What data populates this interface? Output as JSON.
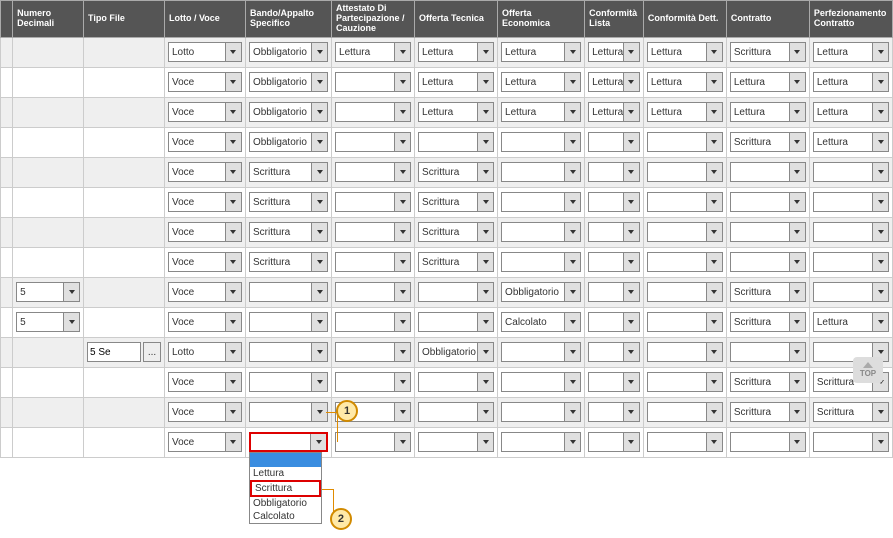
{
  "headers": [
    "Numero Decimali",
    "Tipo File",
    "Lotto / Voce",
    "Bando/Appalto Specifico",
    "Attestato Di Partecipazione / Cauzione",
    "Offerta Tecnica",
    "Offerta Economica",
    "Conformità Lista",
    "Conformità Dett.",
    "Contratto",
    "Perfezionamento Contratto"
  ],
  "rows": [
    {
      "bg": "even",
      "cells": {
        "c2": {
          "type": "sel",
          "val": "Lotto"
        },
        "c3": {
          "type": "sel",
          "val": "Obbligatorio"
        },
        "c4": {
          "type": "sel",
          "val": "Lettura"
        },
        "c5": {
          "type": "sel",
          "val": "Lettura"
        },
        "c6": {
          "type": "sel",
          "val": "Lettura"
        },
        "c7": {
          "type": "sel",
          "val": "Lettura"
        },
        "c8": {
          "type": "sel",
          "val": "Lettura"
        },
        "c9": {
          "type": "sel",
          "val": "Scrittura"
        },
        "c10": {
          "type": "sel",
          "val": "Lettura"
        }
      }
    },
    {
      "bg": "odd",
      "cells": {
        "c2": {
          "type": "sel",
          "val": "Voce"
        },
        "c3": {
          "type": "sel",
          "val": "Obbligatorio"
        },
        "c4": {
          "type": "sel",
          "val": ""
        },
        "c5": {
          "type": "sel",
          "val": "Lettura"
        },
        "c6": {
          "type": "sel",
          "val": "Lettura"
        },
        "c7": {
          "type": "sel",
          "val": "Lettura"
        },
        "c8": {
          "type": "sel",
          "val": "Lettura"
        },
        "c9": {
          "type": "sel",
          "val": "Lettura"
        },
        "c10": {
          "type": "sel",
          "val": "Lettura"
        }
      }
    },
    {
      "bg": "even",
      "cells": {
        "c2": {
          "type": "sel",
          "val": "Voce"
        },
        "c3": {
          "type": "sel",
          "val": "Obbligatorio"
        },
        "c4": {
          "type": "sel",
          "val": ""
        },
        "c5": {
          "type": "sel",
          "val": "Lettura"
        },
        "c6": {
          "type": "sel",
          "val": "Lettura"
        },
        "c7": {
          "type": "sel",
          "val": "Lettura"
        },
        "c8": {
          "type": "sel",
          "val": "Lettura"
        },
        "c9": {
          "type": "sel",
          "val": "Lettura"
        },
        "c10": {
          "type": "sel",
          "val": "Lettura"
        }
      }
    },
    {
      "bg": "odd",
      "cells": {
        "c2": {
          "type": "sel",
          "val": "Voce"
        },
        "c3": {
          "type": "sel",
          "val": "Obbligatorio"
        },
        "c4": {
          "type": "sel",
          "val": ""
        },
        "c5": {
          "type": "sel",
          "val": ""
        },
        "c6": {
          "type": "sel",
          "val": ""
        },
        "c7": {
          "type": "sel",
          "val": ""
        },
        "c8": {
          "type": "sel",
          "val": ""
        },
        "c9": {
          "type": "sel",
          "val": "Scrittura"
        },
        "c10": {
          "type": "sel",
          "val": "Lettura"
        }
      }
    },
    {
      "bg": "even",
      "cells": {
        "c2": {
          "type": "sel",
          "val": "Voce"
        },
        "c3": {
          "type": "sel",
          "val": "Scrittura"
        },
        "c4": {
          "type": "sel",
          "val": ""
        },
        "c5": {
          "type": "sel",
          "val": "Scrittura"
        },
        "c6": {
          "type": "sel",
          "val": ""
        },
        "c7": {
          "type": "sel",
          "val": ""
        },
        "c8": {
          "type": "sel",
          "val": ""
        },
        "c9": {
          "type": "sel",
          "val": ""
        },
        "c10": {
          "type": "sel",
          "val": ""
        }
      }
    },
    {
      "bg": "odd",
      "cells": {
        "c2": {
          "type": "sel",
          "val": "Voce"
        },
        "c3": {
          "type": "sel",
          "val": "Scrittura"
        },
        "c4": {
          "type": "sel",
          "val": ""
        },
        "c5": {
          "type": "sel",
          "val": "Scrittura"
        },
        "c6": {
          "type": "sel",
          "val": ""
        },
        "c7": {
          "type": "sel",
          "val": ""
        },
        "c8": {
          "type": "sel",
          "val": ""
        },
        "c9": {
          "type": "sel",
          "val": ""
        },
        "c10": {
          "type": "sel",
          "val": ""
        }
      }
    },
    {
      "bg": "even",
      "cells": {
        "c2": {
          "type": "sel",
          "val": "Voce"
        },
        "c3": {
          "type": "sel",
          "val": "Scrittura"
        },
        "c4": {
          "type": "sel",
          "val": ""
        },
        "c5": {
          "type": "sel",
          "val": "Scrittura"
        },
        "c6": {
          "type": "sel",
          "val": ""
        },
        "c7": {
          "type": "sel",
          "val": ""
        },
        "c8": {
          "type": "sel",
          "val": ""
        },
        "c9": {
          "type": "sel",
          "val": ""
        },
        "c10": {
          "type": "sel",
          "val": ""
        }
      }
    },
    {
      "bg": "odd",
      "cells": {
        "c2": {
          "type": "sel",
          "val": "Voce"
        },
        "c3": {
          "type": "sel",
          "val": "Scrittura"
        },
        "c4": {
          "type": "sel",
          "val": ""
        },
        "c5": {
          "type": "sel",
          "val": "Scrittura"
        },
        "c6": {
          "type": "sel",
          "val": ""
        },
        "c7": {
          "type": "sel",
          "val": ""
        },
        "c8": {
          "type": "sel",
          "val": ""
        },
        "c9": {
          "type": "sel",
          "val": ""
        },
        "c10": {
          "type": "sel",
          "val": ""
        }
      }
    },
    {
      "bg": "even",
      "cells": {
        "c0": {
          "type": "sel",
          "val": "5"
        },
        "c2": {
          "type": "sel",
          "val": "Voce"
        },
        "c3": {
          "type": "sel",
          "val": ""
        },
        "c4": {
          "type": "sel",
          "val": ""
        },
        "c5": {
          "type": "sel",
          "val": ""
        },
        "c6": {
          "type": "sel",
          "val": "Obbligatorio"
        },
        "c7": {
          "type": "sel",
          "val": ""
        },
        "c8": {
          "type": "sel",
          "val": ""
        },
        "c9": {
          "type": "sel",
          "val": "Scrittura"
        },
        "c10": {
          "type": "sel",
          "val": ""
        }
      }
    },
    {
      "bg": "odd",
      "cells": {
        "c0": {
          "type": "sel",
          "val": "5"
        },
        "c2": {
          "type": "sel",
          "val": "Voce"
        },
        "c3": {
          "type": "sel",
          "val": ""
        },
        "c4": {
          "type": "sel",
          "val": ""
        },
        "c5": {
          "type": "sel",
          "val": ""
        },
        "c6": {
          "type": "sel",
          "val": "Calcolato"
        },
        "c7": {
          "type": "sel",
          "val": ""
        },
        "c8": {
          "type": "sel",
          "val": ""
        },
        "c9": {
          "type": "sel",
          "val": "Scrittura"
        },
        "c10": {
          "type": "sel",
          "val": "Lettura"
        }
      }
    },
    {
      "bg": "even",
      "cells": {
        "c1": {
          "type": "tipo",
          "val": "5 Se"
        },
        "c2": {
          "type": "sel",
          "val": "Lotto"
        },
        "c3": {
          "type": "sel",
          "val": ""
        },
        "c4": {
          "type": "sel",
          "val": ""
        },
        "c5": {
          "type": "sel",
          "val": "Obbligatorio"
        },
        "c6": {
          "type": "sel",
          "val": ""
        },
        "c7": {
          "type": "sel",
          "val": ""
        },
        "c8": {
          "type": "sel",
          "val": ""
        },
        "c9": {
          "type": "sel",
          "val": ""
        },
        "c10": {
          "type": "sel",
          "val": ""
        }
      }
    },
    {
      "bg": "odd",
      "cells": {
        "c2": {
          "type": "sel",
          "val": "Voce"
        },
        "c3": {
          "type": "sel",
          "val": ""
        },
        "c4": {
          "type": "sel",
          "val": ""
        },
        "c5": {
          "type": "sel",
          "val": ""
        },
        "c6": {
          "type": "sel",
          "val": ""
        },
        "c7": {
          "type": "sel",
          "val": ""
        },
        "c8": {
          "type": "sel",
          "val": ""
        },
        "c9": {
          "type": "sel",
          "val": "Scrittura"
        },
        "c10": {
          "type": "sel",
          "val": "Scrittura"
        }
      }
    },
    {
      "bg": "even",
      "cells": {
        "c2": {
          "type": "sel",
          "val": "Voce"
        },
        "c3": {
          "type": "sel",
          "val": "",
          "mark": 1
        },
        "c4": {
          "type": "sel",
          "val": ""
        },
        "c5": {
          "type": "sel",
          "val": ""
        },
        "c6": {
          "type": "sel",
          "val": ""
        },
        "c7": {
          "type": "sel",
          "val": ""
        },
        "c8": {
          "type": "sel",
          "val": ""
        },
        "c9": {
          "type": "sel",
          "val": "Scrittura"
        },
        "c10": {
          "type": "sel",
          "val": "Scrittura"
        }
      }
    },
    {
      "bg": "odd",
      "cells": {
        "c2": {
          "type": "sel",
          "val": "Voce"
        },
        "c3": {
          "type": "sel",
          "val": "",
          "open": true
        },
        "c4": {
          "type": "sel",
          "val": ""
        },
        "c5": {
          "type": "sel",
          "val": ""
        },
        "c6": {
          "type": "sel",
          "val": ""
        },
        "c7": {
          "type": "sel",
          "val": ""
        },
        "c8": {
          "type": "sel",
          "val": ""
        },
        "c9": {
          "type": "sel",
          "val": ""
        },
        "c10": {
          "type": "sel",
          "val": ""
        }
      }
    }
  ],
  "dropdown": {
    "options": [
      "",
      "Lettura",
      "Scrittura",
      "Obbligatorio",
      "Calcolato"
    ],
    "selected": "Scrittura"
  },
  "markers": {
    "m1": "1",
    "m2": "2"
  },
  "dotsLabel": "...",
  "topLabel": "TOP"
}
